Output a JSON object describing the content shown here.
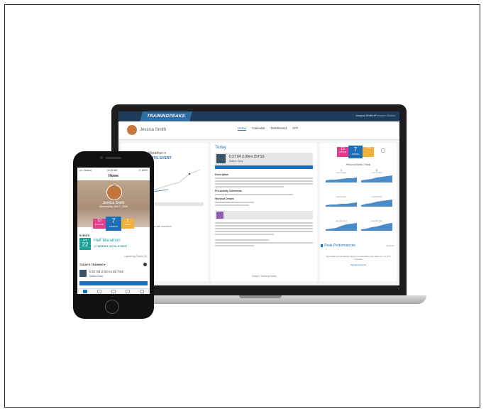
{
  "laptop": {
    "topbar": {
      "logo": "TRAININGPEAKS",
      "user_name": "Jessica Smith ▾",
      "premium_link": "Premium Status"
    },
    "header": {
      "athlete_name": "Jessica Smith",
      "nav": [
        "Home",
        "Calendar",
        "Dashboard",
        "ATP"
      ]
    },
    "left_panel": {
      "event_name": "Marathon ▾",
      "weeks": "UNTIL EVENT",
      "chart_label": "Today ▸ 11 ▸",
      "footer_text": "my the half marathon"
    },
    "today_panel": {
      "title": "Today",
      "workout_stats": "0:27:04   2.00mi   25TSS",
      "workout_sub": "Station Easy",
      "description_h": "Description",
      "pre_comments_h": "Pre-activity Comments",
      "workout_details_h": "Workout Details",
      "footer": "Today's Training Notes"
    },
    "right_panel": {
      "metrics": [
        {
          "num": "13",
          "label": "FATIGUE",
          "color": "#e23b8a"
        },
        {
          "num": "7",
          "label": "FITNESS",
          "color": "#1d6fb8"
        },
        {
          "num": "",
          "label": "FORM",
          "color": "#f2b13b"
        }
      ],
      "records_title": "Personal Bests / Rank",
      "records": [
        {
          "value": "1",
          "caption": "Last 10 days",
          "shape": [
            9,
            8,
            8,
            7,
            6,
            6,
            5
          ]
        },
        {
          "value": "2",
          "caption": "Last 10 days",
          "shape": [
            9,
            8,
            7,
            5,
            4,
            3,
            2
          ]
        },
        {
          "value": "",
          "caption": "Last 90 days",
          "shape": [
            10,
            9,
            9,
            8,
            8,
            7,
            6
          ]
        },
        {
          "value": "",
          "caption": "Last 90 days",
          "shape": [
            10,
            8,
            7,
            5,
            4,
            3,
            2
          ]
        },
        {
          "value": "",
          "caption": "Last 365 days",
          "shape": [
            10,
            9,
            8,
            5,
            3,
            2,
            1
          ]
        },
        {
          "value": "",
          "caption": "Last 365 days",
          "shape": [
            10,
            9,
            7,
            6,
            4,
            2,
            1
          ]
        }
      ],
      "pp_title": "Peak Performances",
      "pp_view_all": "View All",
      "pp_text": "Start setting Peak Performances by uploading your data, run, or FTP workouts.",
      "pp_link": "Upload workouts"
    }
  },
  "phone": {
    "status": {
      "left": "•••• Verizon",
      "center": "11:00 AM",
      "right": "✈ 100%"
    },
    "title": "Home",
    "profile": {
      "name": "Jessica Smith",
      "date": "Wednesday, Mar 7, 2018"
    },
    "metrics": [
      {
        "num": "13",
        "label": "FATIGUE",
        "color": "#e23b8a"
      },
      {
        "num": "7",
        "label": "FITNESS",
        "color": "#1d6fb8"
      },
      {
        "num": "3",
        "label": "FORM",
        "color": "#f2b13b"
      }
    ],
    "events_h": "EVENTS",
    "event": {
      "month": "APR",
      "day": "22",
      "name": "Half Marathon",
      "weeks": "17 WEEKS UNTIL EVENT"
    },
    "upcoming_link": "Upcoming Events (3)",
    "today_h": "TODAY'S TRAINING ▾",
    "workout": {
      "stats": "0:27:04    2.00 mi    35 TSS",
      "sub": "Station Easy"
    }
  }
}
